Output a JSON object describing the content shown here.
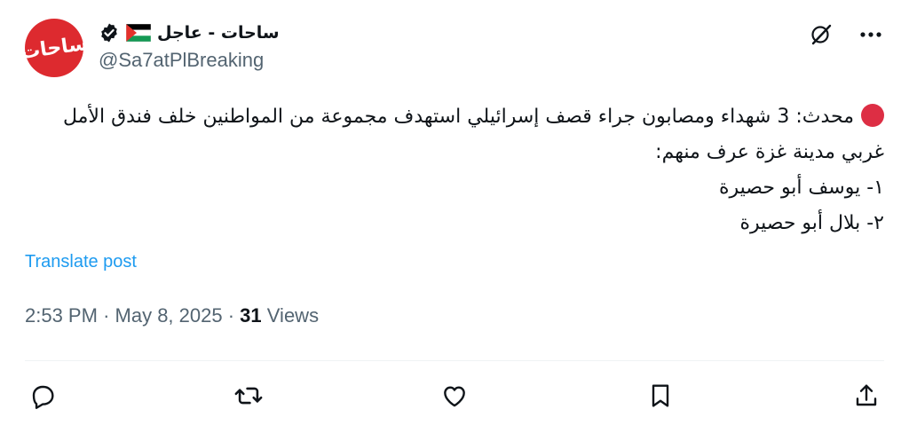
{
  "author": {
    "display_name": "ساحات - عاجل",
    "handle": "@Sa7atPlBreaking",
    "avatar_text": "ساحات",
    "flag_icon": "palestine-flag-icon",
    "verified_icon": "verified-badge-icon"
  },
  "header_actions": {
    "grok_icon": "grok-icon",
    "more_icon": "more-icon"
  },
  "post": {
    "lines": [
      "محدث: 3 شهداء ومصابون جراء قصف إسرائيلي استهدف مجموعة من المواطنين خلف فندق الأمل",
      "غربي مدينة غزة عرف منهم:",
      "١- يوسف أبو حصيرة",
      "٢- بلال أبو حصيرة"
    ],
    "translate_label": "Translate post"
  },
  "meta": {
    "time": "2:53 PM",
    "separator": "·",
    "date": "May 8, 2025",
    "views_count": "31",
    "views_label": "Views"
  },
  "actions": [
    {
      "name": "reply",
      "icon": "reply-icon"
    },
    {
      "name": "repost",
      "icon": "repost-icon"
    },
    {
      "name": "like",
      "icon": "like-icon"
    },
    {
      "name": "bookmark",
      "icon": "bookmark-icon"
    },
    {
      "name": "share",
      "icon": "share-icon"
    }
  ],
  "colors": {
    "accent": "#1d9bf0",
    "secondary_text": "#536471",
    "avatar_bg": "#dd2a2f",
    "red_dot": "#dd2e44"
  }
}
